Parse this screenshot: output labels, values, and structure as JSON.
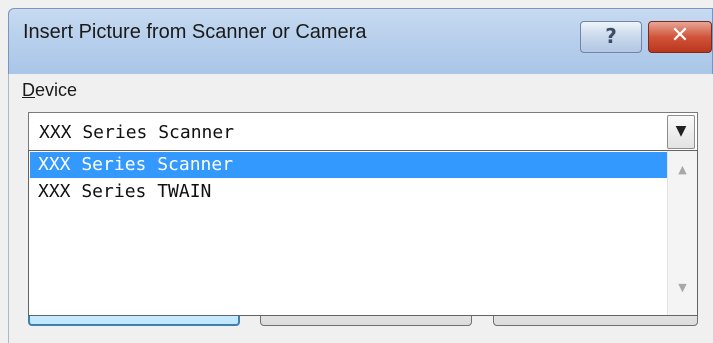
{
  "window": {
    "title": "Insert Picture from Scanner or Camera",
    "help_glyph": "?",
    "close_glyph": "✕"
  },
  "device": {
    "label_accel": "D",
    "label_rest": "evice",
    "selected_value": "XXX Series Scanner",
    "dropdown_arrow": "▼",
    "options": [
      {
        "label": "XXX Series Scanner",
        "selected": true
      },
      {
        "label": "XXX Series TWAIN",
        "selected": false
      }
    ]
  },
  "scrollbar": {
    "up_glyph": "▲",
    "down_glyph": "▼"
  },
  "buttons": {
    "btn1_label": "",
    "btn2_label": "",
    "btn3_label": ""
  },
  "colors": {
    "selection": "#3399ff",
    "close_button": "#d1543a",
    "title_bar": "#b8d0ec"
  }
}
